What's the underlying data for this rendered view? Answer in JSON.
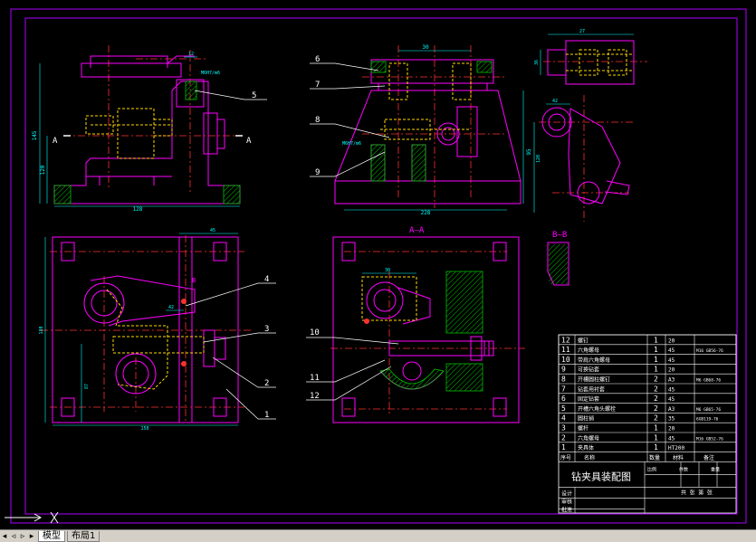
{
  "colors": {
    "background": "#000000",
    "frame": "#aa00ff",
    "outline": "#ff00ff",
    "centerline": "#ff3030",
    "hidden": "#ffd700",
    "dimension": "#00ffff",
    "leader": "#ffffff",
    "hatch": "#00c000",
    "part_yellow": "#ffff00"
  },
  "callouts": [
    "1",
    "2",
    "3",
    "4",
    "5",
    "6",
    "7",
    "8",
    "9",
    "10",
    "11",
    "12"
  ],
  "section_label": "A—A",
  "section_b_label": "B—B",
  "section_mark": "A",
  "title_block": {
    "title": "钻夹具装配图",
    "parts": [
      {
        "no": "12",
        "name": "螺钉",
        "qty": "1",
        "material": "20",
        "note": ""
      },
      {
        "no": "11",
        "name": "六角螺母",
        "qty": "1",
        "material": "45",
        "note": "M16 GB56-76"
      },
      {
        "no": "10",
        "name": "带肩六角螺母",
        "qty": "1",
        "material": "45",
        "note": ""
      },
      {
        "no": "9",
        "name": "可换钻套",
        "qty": "1",
        "material": "20",
        "note": ""
      },
      {
        "no": "8",
        "name": "开槽圆柱螺钉",
        "qty": "2",
        "material": "A3",
        "note": "M6 GB68-76"
      },
      {
        "no": "7",
        "name": "钻套用衬套",
        "qty": "2",
        "material": "45",
        "note": ""
      },
      {
        "no": "6",
        "name": "固定钻套",
        "qty": "2",
        "material": "45",
        "note": ""
      },
      {
        "no": "5",
        "name": "开槽六角头螺栓",
        "qty": "2",
        "material": "A3",
        "note": "M6 GB65-76"
      },
      {
        "no": "4",
        "name": "圆柱销",
        "qty": "2",
        "material": "35",
        "note": "6GB119-76"
      },
      {
        "no": "3",
        "name": "螺杆",
        "qty": "1",
        "material": "20",
        "note": ""
      },
      {
        "no": "2",
        "name": "六角螺母",
        "qty": "1",
        "material": "45",
        "note": "M16 GB52-76"
      },
      {
        "no": "1",
        "name": "夹具体",
        "qty": "1",
        "material": "HT200",
        "note": ""
      }
    ],
    "header": [
      "序号",
      "名称",
      "数量",
      "材料",
      "备注"
    ],
    "side_labels": [
      "设计",
      "审核",
      "批准"
    ],
    "mid_labels": [
      "比例",
      "件数",
      "重量"
    ],
    "footer": "共 张 第 张"
  },
  "dimensions": {
    "top_left_width": "128",
    "top_left_height_outer": "145",
    "top_left_height_inner": "120",
    "top_left_small": "12",
    "top_left_fit": "M6H7/m6",
    "top_mid_width": "30",
    "top_mid_base": "228",
    "top_mid_height": "95",
    "top_mid_fit": "M6H7/m6",
    "bottom_left_width": "150",
    "bottom_left_height": "180",
    "bottom_left_small": "45",
    "bottom_left_small2": "42",
    "bottom_left_side": "87",
    "bottom_mid_small": "30",
    "right_top_width": "27",
    "right_top_height": "36",
    "right_mid_small": "42",
    "right_mid_height": "120"
  },
  "tabs": {
    "model": "模型",
    "layout": "布局1"
  }
}
